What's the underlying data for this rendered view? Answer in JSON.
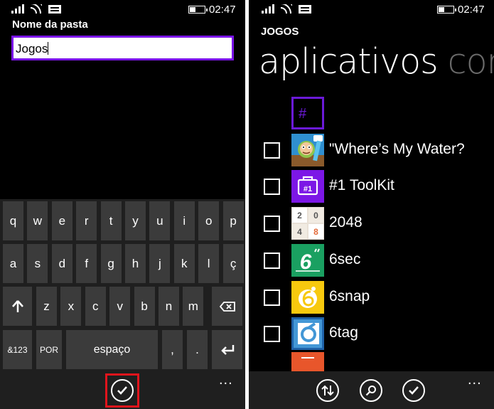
{
  "left": {
    "status": {
      "time": "02:47"
    },
    "folder_name_label": "Nome da pasta",
    "folder_name_value": "Jogos",
    "keyboard": {
      "row1": [
        "q",
        "w",
        "e",
        "r",
        "t",
        "y",
        "u",
        "i",
        "o",
        "p"
      ],
      "row2": [
        "a",
        "s",
        "d",
        "f",
        "g",
        "h",
        "j",
        "k",
        "l",
        "ç"
      ],
      "row3_letters": [
        "z",
        "x",
        "c",
        "v",
        "b",
        "n",
        "m"
      ],
      "symbols_label": "&123",
      "language_label": "POR",
      "space_label": "espaço",
      "comma": ",",
      "period": "."
    },
    "appbar": {
      "more": "..."
    }
  },
  "right": {
    "status": {
      "time": "02:47"
    },
    "section_title": "JOGOS",
    "pivot_active": "aplicativos",
    "pivot_next": "con",
    "group_letter": "#",
    "apps": [
      {
        "name": "\"Where’s My Water?",
        "tile_color": "#1e88c8",
        "icon": "wheres-my-water-icon"
      },
      {
        "name": "#1 ToolKit",
        "tile_color": "#7c17e6",
        "icon": "toolkit-icon",
        "tile_label": "#1"
      },
      {
        "name": "2048",
        "tile_color": "#f1ebe2",
        "icon": "2048-icon",
        "tile_numbers": [
          "2",
          "0",
          "4",
          "8"
        ]
      },
      {
        "name": "6sec",
        "tile_color": "#1aa061",
        "icon": "6sec-icon",
        "tile_label": "6"
      },
      {
        "name": "6snap",
        "tile_color": "#f7c90e",
        "icon": "6snap-icon"
      },
      {
        "name": "6tag",
        "tile_color": "#4397d6",
        "icon": "6tag-icon"
      }
    ],
    "partial_tile_color": "#e8562b",
    "appbar": {
      "more": "..."
    }
  }
}
